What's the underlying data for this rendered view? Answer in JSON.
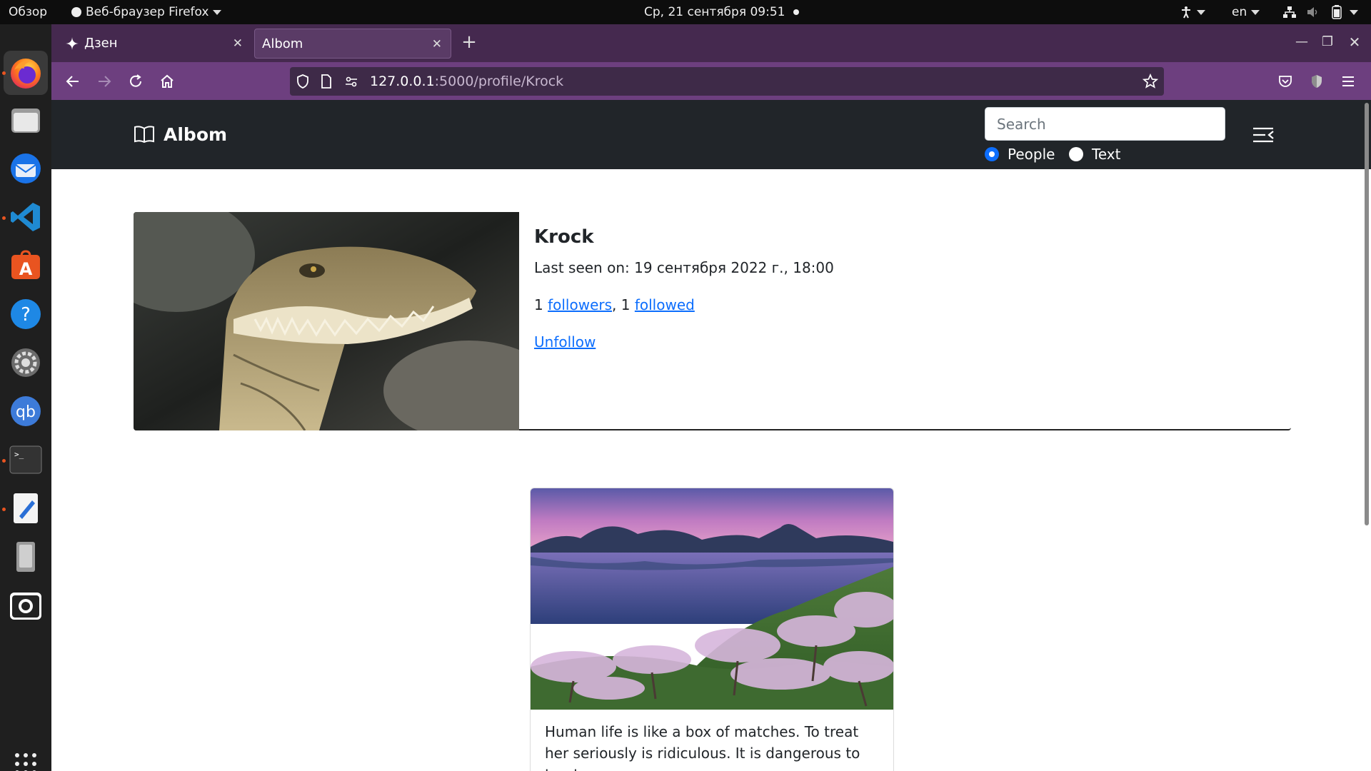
{
  "system_bar": {
    "activities": "Обзор",
    "app_menu": "Веб-браузер Firefox",
    "clock": "Ср, 21 сентября  09:51",
    "language": "en"
  },
  "dock": {
    "items": [
      "firefox-icon",
      "files-icon",
      "thunderbird-icon",
      "vscode-icon",
      "app-center-icon",
      "help-icon",
      "settings-icon",
      "qbittorrent-icon",
      "terminal-icon",
      "text-editor-icon",
      "removable-drive-icon",
      "screenshot-icon",
      "app-grid-icon"
    ]
  },
  "browser": {
    "tabs": [
      {
        "title": "Дзен",
        "active": false
      },
      {
        "title": "Albom",
        "active": true
      }
    ],
    "url_host": "127.0.0.1",
    "url_rest": ":5000/profile/Krock",
    "colors": {
      "tabbar": "#45294f",
      "toolbar": "#6d3f7f",
      "urlbar": "#3e2a48"
    }
  },
  "site": {
    "brand": "Albom",
    "search": {
      "placeholder": "Search"
    },
    "search_modes": [
      {
        "label": "People",
        "checked": true
      },
      {
        "label": "Text",
        "checked": false
      }
    ],
    "colors": {
      "navbar": "#212529",
      "link": "#0d6efd"
    }
  },
  "profile": {
    "name": "Krock",
    "last_seen_label": "Last seen on:",
    "last_seen_value": "19 сентября 2022 г., 18:00",
    "followers_count": "1",
    "followers_label": "followers",
    "followed_count": "1",
    "followed_label": "followed",
    "unfollow_label": "Unfollow"
  },
  "post": {
    "text": "Human life is like a box of matches. To treat her seriously is ridiculous. It is dangerous to treat"
  }
}
